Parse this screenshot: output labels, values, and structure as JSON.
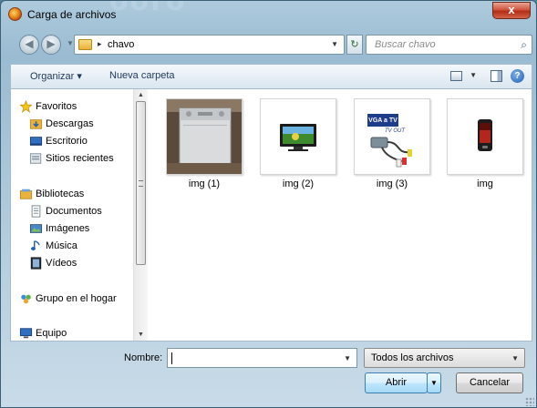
{
  "window": {
    "title": "Carga de archivos",
    "close_glyph": "x"
  },
  "address_bar": {
    "path_separator": "▸",
    "current_folder": "chavo"
  },
  "search": {
    "placeholder": "Buscar chavo"
  },
  "toolbar": {
    "organize_label": "Organizar ▾",
    "new_folder_label": "Nueva carpeta",
    "help_glyph": "?"
  },
  "sidebar": {
    "items": [
      {
        "label": "Favoritos",
        "icon": "star-icon"
      },
      {
        "label": "Descargas",
        "icon": "downloads-folder-icon"
      },
      {
        "label": "Escritorio",
        "icon": "desktop-icon"
      },
      {
        "label": "Sitios recientes",
        "icon": "recent-places-icon"
      },
      {
        "label": "Bibliotecas",
        "icon": "libraries-icon"
      },
      {
        "label": "Documentos",
        "icon": "documents-icon"
      },
      {
        "label": "Imágenes",
        "icon": "pictures-icon"
      },
      {
        "label": "Música",
        "icon": "music-icon"
      },
      {
        "label": "Vídeos",
        "icon": "videos-icon"
      },
      {
        "label": "Grupo en el hogar",
        "icon": "homegroup-icon"
      },
      {
        "label": "Equipo",
        "icon": "computer-icon"
      }
    ]
  },
  "files": [
    {
      "label": "img (1)",
      "thumbnail": "washing-machine-photo"
    },
    {
      "label": "img (2)",
      "thumbnail": "television-image"
    },
    {
      "label": "img (3)",
      "thumbnail": "vga-to-tv-cable-image"
    },
    {
      "label": "img",
      "thumbnail": "mobile-phone-image"
    }
  ],
  "bottom": {
    "name_label": "Nombre:",
    "name_value": "",
    "file_type_selected": "Todos los archivos",
    "open_label": "Abrir",
    "cancel_label": "Cancelar"
  },
  "thumbnail_texts": {
    "cable_brand_line1": "VGA a TV",
    "cable_brand_line2": "TV OUT"
  },
  "background_text": "ooro",
  "colors": {
    "close_button": "#c8462b",
    "link_blue": "#1e395b",
    "accent_button": "#a7d9f5"
  }
}
